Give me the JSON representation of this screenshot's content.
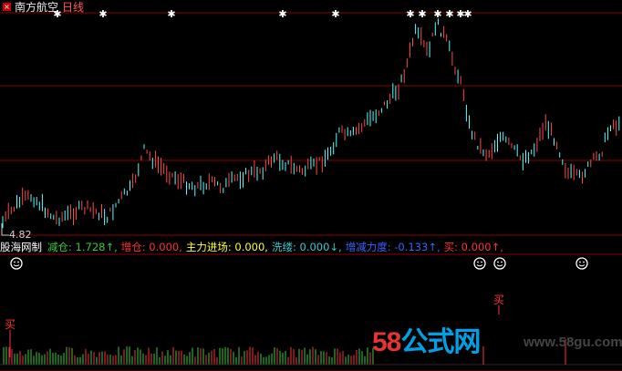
{
  "header": {
    "stock_name": "南方航空",
    "period": "日线",
    "close_icon": "close-icon"
  },
  "price_panel": {
    "min_label": "4.82"
  },
  "indicator": {
    "name": "股海网制",
    "items": [
      {
        "label": "减仓",
        "value": "1.728",
        "arrow": "↑",
        "color": "#33cc33"
      },
      {
        "label": "增仓",
        "value": "0.000",
        "arrow": "",
        "color": "#ff3333"
      },
      {
        "label": "主力进场",
        "value": "0.000",
        "arrow": "",
        "color": "#ffff33"
      },
      {
        "label": "洗缕",
        "value": "0.000",
        "arrow": "↓",
        "color": "#33cccc"
      },
      {
        "label": "增减力度",
        "value": "-0.133",
        "arrow": "↑",
        "color": "#3366ff"
      },
      {
        "label": "买",
        "value": "0.000",
        "arrow": "↑",
        "color": "#ff3333"
      }
    ]
  },
  "signals": {
    "buy_label": "买"
  },
  "watermark": {
    "brand_num": "58",
    "brand_text": "公式网",
    "url": "www.58gu.com"
  },
  "colors": {
    "up": "#ff4a4a",
    "down": "#54ffff",
    "gridline": "#8a0000",
    "star": "#ffffff",
    "smiley": "#ffffff"
  }
}
